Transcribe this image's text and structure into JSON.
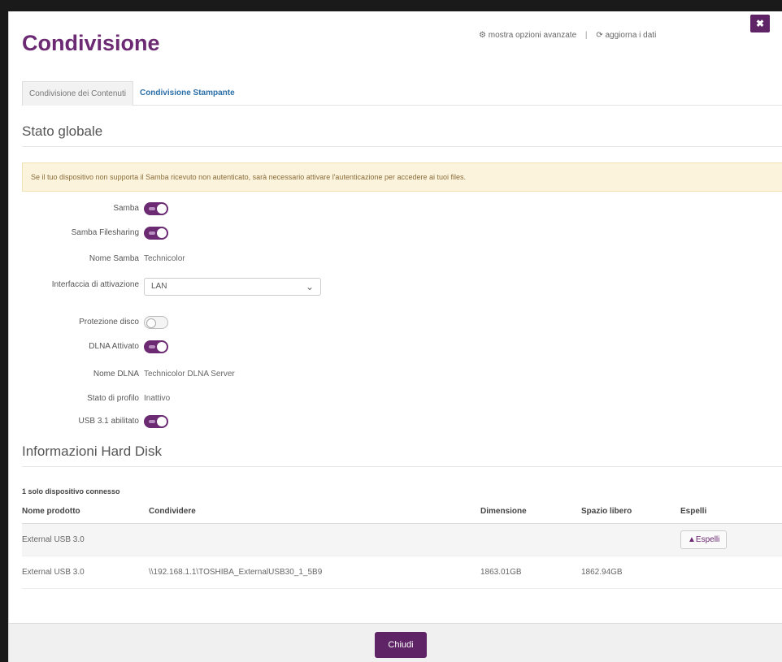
{
  "window": {
    "title": "Condivisione",
    "advanced_link": "⚙ mostra opzioni avanzate",
    "separator": "|",
    "refresh_link": "⟳ aggiorna i dati",
    "close_label": "✖"
  },
  "tabs": [
    {
      "label": "Condivisione dei Contenuti",
      "active": true
    },
    {
      "label": "Condivisione Stampante",
      "active": false
    }
  ],
  "global": {
    "section_title": "Stato globale",
    "warning": "Se il tuo dispositivo non supporta il Samba ricevuto non autenticato, sarà necessario attivare l'autenticazione per accedere ai tuoi files.",
    "fields": {
      "samba": {
        "label": "Samba",
        "state": "on"
      },
      "samba_filesharing": {
        "label": "Samba Filesharing",
        "state": "on"
      },
      "samba_name": {
        "label": "Nome Samba",
        "value": "Technicolor"
      },
      "interface": {
        "label": "Interfaccia di attivazione",
        "value": "LAN"
      },
      "disk_protection": {
        "label": "Protezione disco",
        "state": "off"
      },
      "dlna": {
        "label": "DLNA Attivato",
        "state": "on"
      },
      "dlna_name": {
        "label": "Nome DLNA",
        "value": "Technicolor DLNA Server"
      },
      "profile_state": {
        "label": "Stato di profilo",
        "value": "Inattivo"
      },
      "usb": {
        "label": "USB 3.1 abilitato",
        "state": "on"
      }
    }
  },
  "harddisk": {
    "section_title": "Informazioni Hard Disk",
    "caption": "1 solo dispositivo connesso",
    "columns": [
      "Nome prodotto",
      "Condividere",
      "Dimensione",
      "Spazio libero",
      "Espelli"
    ],
    "rows": [
      [
        "External USB 3.0",
        "",
        "",
        "",
        "▲Espelli"
      ],
      [
        "External USB 3.0",
        "\\\\192.168.1.1\\TOSHIBA_ExternalUSB30_1_5B9",
        "1863.01GB",
        "1862.94GB",
        ""
      ]
    ]
  },
  "footer": {
    "close_button": "Chiudi"
  },
  "colors": {
    "accent": "#6b2a72",
    "button": "#5e2466",
    "link": "#2a6fa8",
    "warning_bg": "#fbf3dc"
  },
  "icons": {
    "advanced": "gear-icon",
    "refresh": "refresh-icon",
    "close": "close-icon",
    "eject": "eject-icon",
    "dropdown": "chevron-down-icon"
  }
}
